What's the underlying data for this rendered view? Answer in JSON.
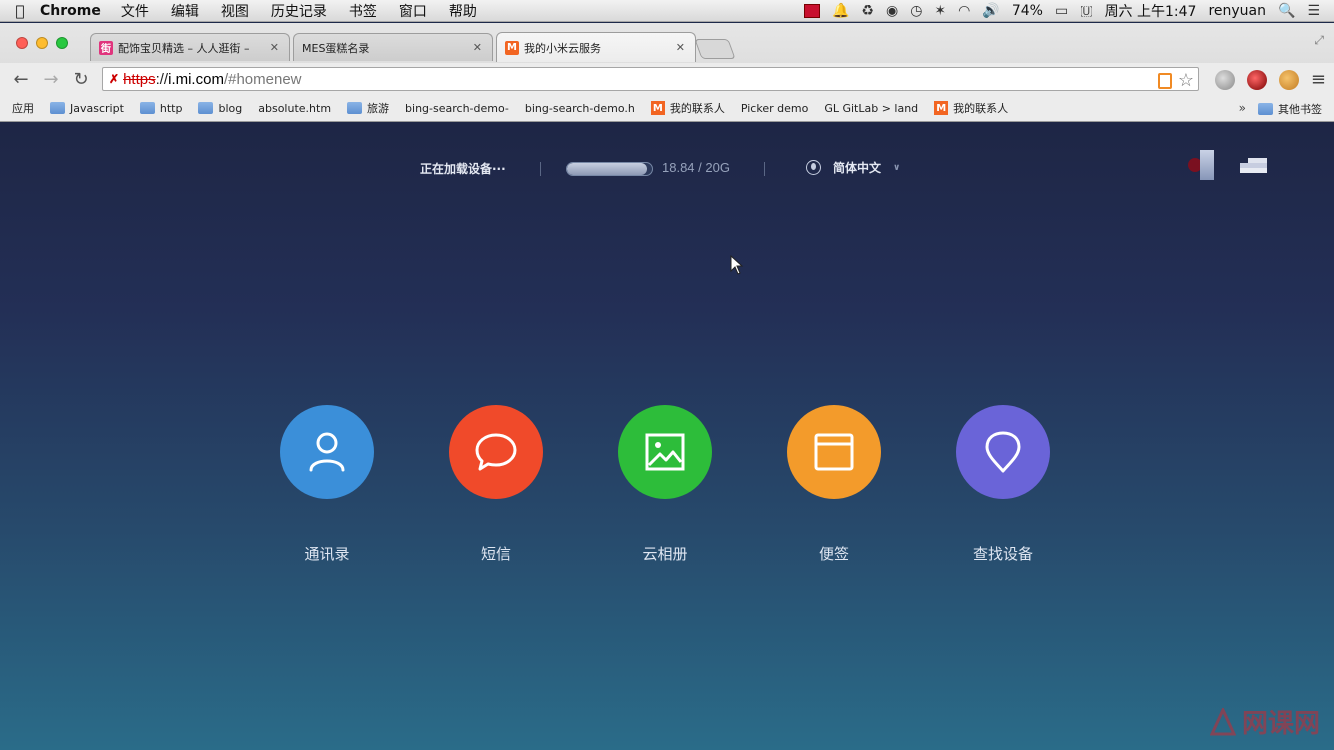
{
  "menubar": {
    "app": "Chrome",
    "items": [
      "文件",
      "编辑",
      "视图",
      "历史记录",
      "书签",
      "窗口",
      "帮助"
    ],
    "battery": "74%",
    "datetime": "周六 上午1:47",
    "user": "renyuan"
  },
  "tabs": [
    {
      "label": "配饰宝贝精选 – 人人逛街 –",
      "favicon": "pink"
    },
    {
      "label": "MES蛋糕名录",
      "favicon": "page"
    },
    {
      "label": "我的小米云服务",
      "favicon": "mi"
    }
  ],
  "omnibox": {
    "scheme": "https",
    "domain": "i.mi.com",
    "path": "/#homenew"
  },
  "bookmarks": {
    "items": [
      {
        "label": "应用",
        "icon": "apps"
      },
      {
        "label": "Javascript",
        "icon": "folder"
      },
      {
        "label": "http",
        "icon": "folder"
      },
      {
        "label": "blog",
        "icon": "folder"
      },
      {
        "label": "absolute.htm",
        "icon": "page"
      },
      {
        "label": "旅游",
        "icon": "folder"
      },
      {
        "label": "bing-search-demo-",
        "icon": "page"
      },
      {
        "label": "bing-search-demo.h",
        "icon": "page"
      },
      {
        "label": "我的联系人",
        "icon": "mi"
      },
      {
        "label": "Picker demo",
        "icon": "page"
      },
      {
        "label": "GL GitLab > land",
        "icon": "none"
      },
      {
        "label": "我的联系人",
        "icon": "mi"
      }
    ],
    "more": "»",
    "other": "其他书签"
  },
  "page": {
    "loading_text": "正在加载设备···",
    "storage_text": "18.84 / 20G",
    "storage_fraction": 0.942,
    "language": "简体中文"
  },
  "apps": [
    {
      "label": "通讯录",
      "color": "#3b8fd9",
      "icon": "contacts-icon"
    },
    {
      "label": "短信",
      "color": "#f04a2a",
      "icon": "message-icon"
    },
    {
      "label": "云相册",
      "color": "#2dbd3a",
      "icon": "gallery-icon"
    },
    {
      "label": "便签",
      "color": "#f39b2b",
      "icon": "notes-icon"
    },
    {
      "label": "查找设备",
      "color": "#6a64d8",
      "icon": "find-device-icon"
    }
  ],
  "watermark": "网课网"
}
